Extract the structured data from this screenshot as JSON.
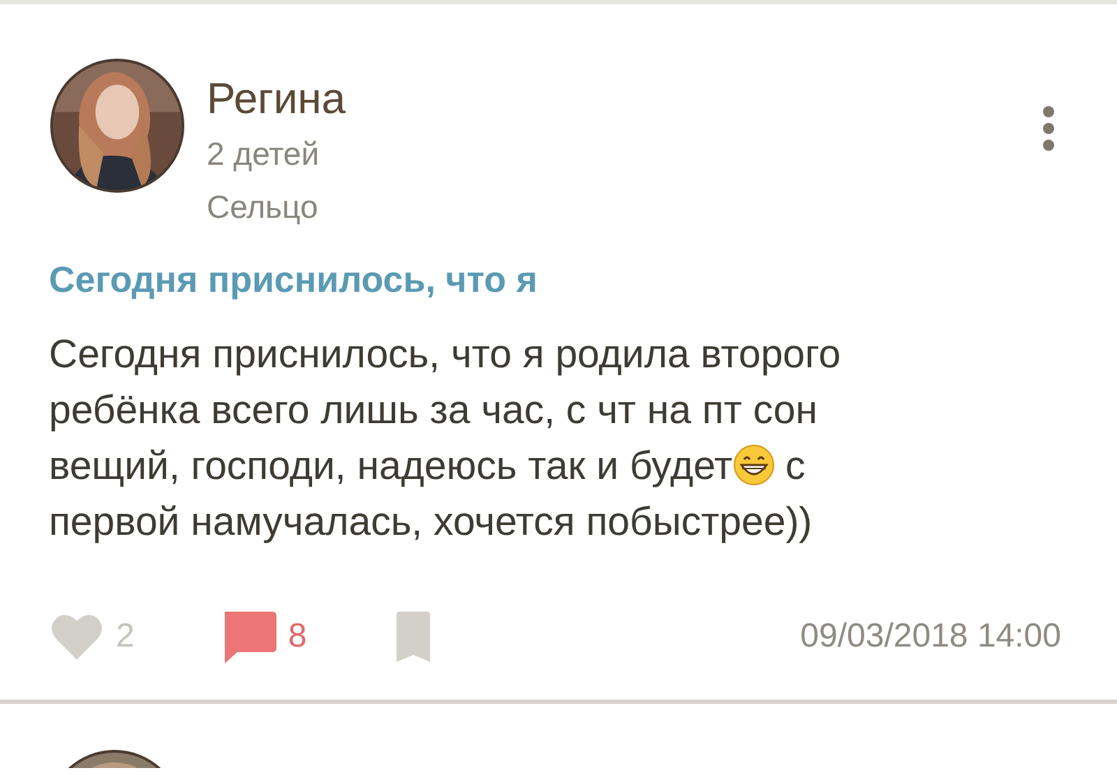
{
  "post": {
    "author": {
      "name": "Регина",
      "children": "2 детей",
      "city": "Сельцо"
    },
    "title": "Сегодня приснилось, что я",
    "body": [
      [
        {
          "kind": "text",
          "text": "Сегодня приснилось, что я родила второго"
        }
      ],
      [
        {
          "kind": "text",
          "text": "ребёнка всего лишь за час, с чт на пт сон"
        }
      ],
      [
        {
          "kind": "text",
          "text": "вещий, господи, надеюсь так и будет"
        },
        {
          "kind": "emoji"
        },
        {
          "kind": "text",
          "text": " с"
        }
      ],
      [
        {
          "kind": "text",
          "text": "первой намучалась, хочется побыстрее))"
        }
      ]
    ],
    "likes": {
      "count": "2",
      "liked": false
    },
    "comments": {
      "count": "8",
      "has_comments": true
    },
    "bookmarked": false,
    "date": "09/03/2018 14:00"
  }
}
